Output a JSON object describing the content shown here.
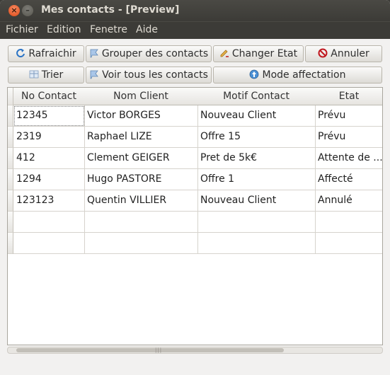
{
  "window": {
    "title": "Mes contacts - [Preview]",
    "close_glyph": "×",
    "minimize_glyph": "–"
  },
  "menu": [
    "Fichier",
    "Edition",
    "Fenetre",
    "Aide"
  ],
  "toolbar": {
    "row1": [
      {
        "label": "Rafraichir",
        "icon": "refresh-icon"
      },
      {
        "label": "Grouper des contacts",
        "icon": "flag-icon"
      },
      {
        "label": "Changer Etat",
        "icon": "pencil-icon"
      },
      {
        "label": "Annuler",
        "icon": "cancel-icon"
      }
    ],
    "row2": [
      {
        "label": "Trier",
        "icon": "sort-icon"
      },
      {
        "label": "Voir tous les contacts",
        "icon": "flag-icon"
      },
      {
        "label": "Mode affectation",
        "icon": "globe-icon"
      }
    ]
  },
  "table": {
    "columns": [
      "No Contact",
      "Nom Client",
      "Motif Contact",
      "Etat"
    ],
    "rows": [
      [
        "12345",
        "Victor BORGES",
        "Nouveau Client",
        "Prévu"
      ],
      [
        "2319",
        "Raphael LIZE",
        "Offre 15",
        "Prévu"
      ],
      [
        "412",
        "Clement GEIGER",
        "Pret de 5k€",
        "Attente de ..."
      ],
      [
        "1294",
        "Hugo PASTORE",
        "Offre 1",
        "Affecté"
      ],
      [
        "123123",
        "Quentin VILLIER",
        "Nouveau Client",
        "Annulé"
      ],
      [
        "",
        "",
        "",
        ""
      ],
      [
        "",
        "",
        "",
        ""
      ]
    ]
  },
  "scrollbar": {
    "grip": "|||"
  },
  "colors": {
    "titlebar": "#3c3b37",
    "close": "#df4a16",
    "cancel": "#c0171f",
    "refresh": "#2a73c5"
  }
}
